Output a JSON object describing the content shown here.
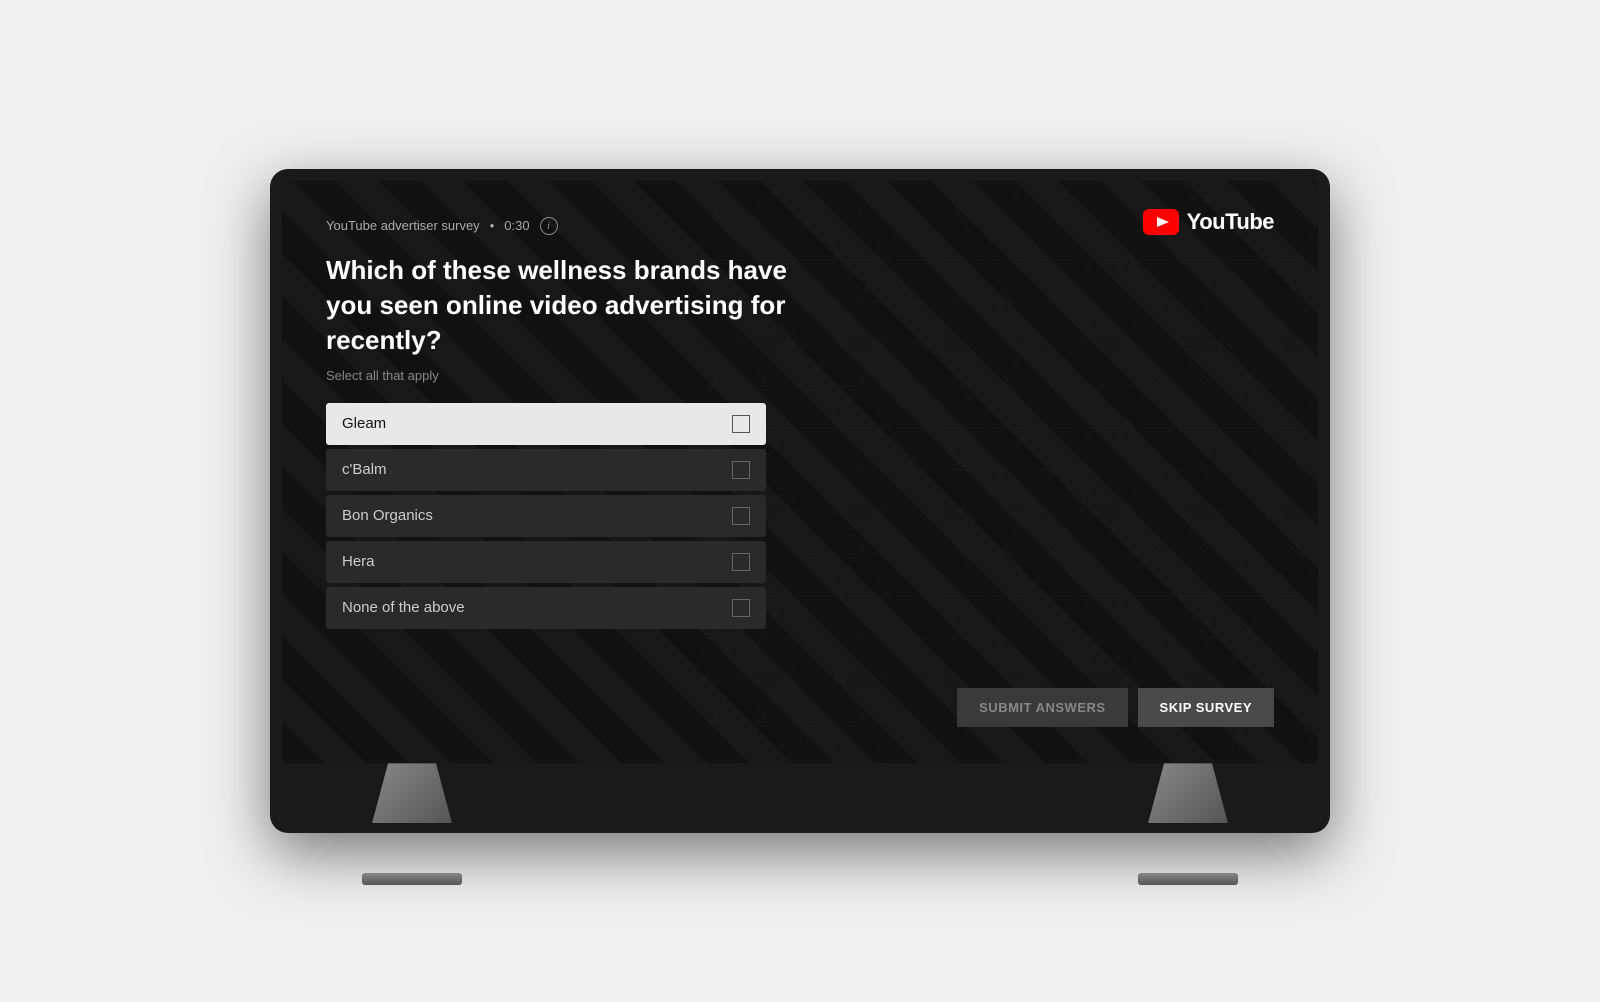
{
  "tv": {
    "screen": {
      "survey": {
        "label": "YouTube advertiser survey",
        "separator": "•",
        "timer": "0:30",
        "question": "Which of these wellness brands have you seen online video advertising for recently?",
        "subtitle": "Select all that apply",
        "options": [
          {
            "id": "gleam",
            "label": "Gleam",
            "highlighted": true,
            "checked": false
          },
          {
            "id": "cbalm",
            "label": "c'Balm",
            "highlighted": false,
            "checked": false
          },
          {
            "id": "bon-organics",
            "label": "Bon Organics",
            "highlighted": false,
            "checked": false
          },
          {
            "id": "hera",
            "label": "Hera",
            "highlighted": false,
            "checked": false
          },
          {
            "id": "none",
            "label": "None of the above",
            "highlighted": false,
            "checked": false
          }
        ]
      },
      "buttons": {
        "submit": "SUBMIT ANSWERS",
        "skip": "SKIP SURVEY"
      },
      "logo": {
        "wordmark": "YouTube"
      }
    }
  }
}
